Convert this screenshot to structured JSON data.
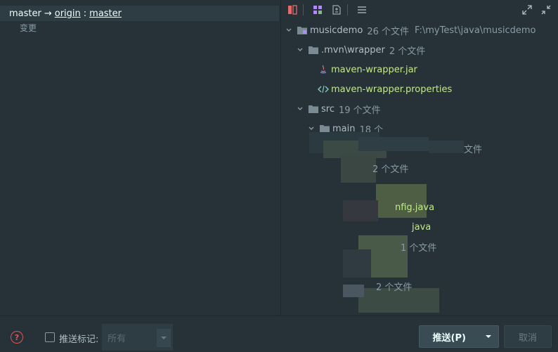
{
  "commit": {
    "branch": "master",
    "arrow": "→",
    "remote": "origin",
    "colon": ":",
    "target": "master"
  },
  "changes_label": "变更",
  "tree": {
    "root": {
      "name": "musicdemo",
      "count": "26 个文件",
      "path": "F:\\myTest\\java\\musicdemo"
    },
    "mvn": {
      "name": ".mvn\\wrapper",
      "count": "2 个文件"
    },
    "jar": {
      "name": "maven-wrapper.jar"
    },
    "props": {
      "name": "maven-wrapper.properties"
    },
    "src": {
      "name": "src",
      "count": "19 个文件"
    },
    "main": {
      "name": "main",
      "count": "18 个"
    },
    "frag1": "文件",
    "frag2": "2 个文件",
    "frag3": "nfig.java",
    "frag4": "java",
    "frag5": "1 个文件",
    "frag6": "2 个文件"
  },
  "bottom": {
    "help": "?",
    "push_tags_label": "推送标记:",
    "select_value": "所有",
    "push_label": "推送(P)",
    "cancel_label": "取消"
  },
  "colors": {
    "background": "#263238",
    "file_green": "#c3e88d",
    "folder": "#7a8b94",
    "accent_purple": "#b388ff",
    "help_red": "#e05555"
  }
}
